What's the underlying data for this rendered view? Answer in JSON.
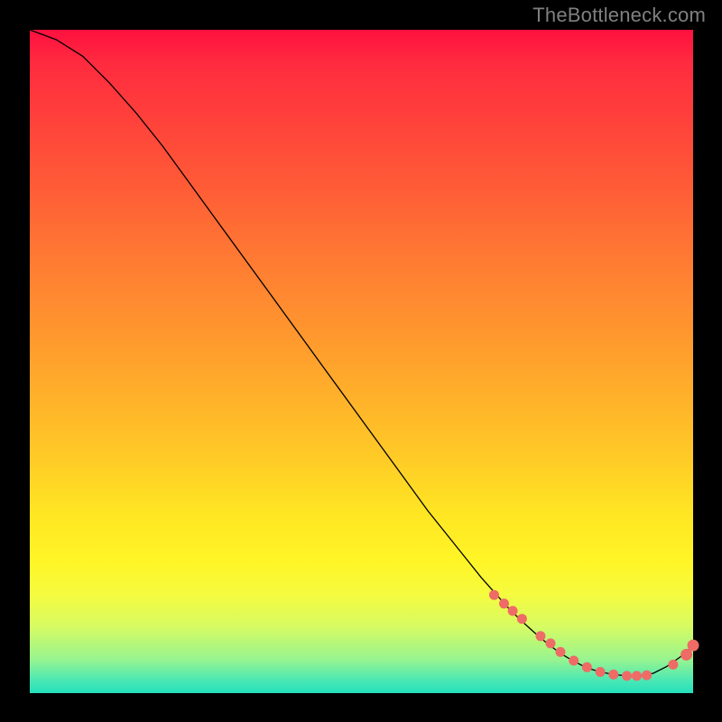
{
  "watermark": "TheBottleneck.com",
  "chart_data": {
    "type": "line",
    "title": "",
    "xlabel": "",
    "ylabel": "",
    "xlim": [
      0,
      100
    ],
    "ylim": [
      0,
      100
    ],
    "grid": false,
    "legend": false,
    "description": "Single black curve over a vertical gradient (red top → green bottom). Curve descends steeply from top-left, flattens to a minimum near x≈84, then rises slightly. Salmon dots mark points along the lower portion of the curve.",
    "series": [
      {
        "name": "curve",
        "x": [
          0,
          4,
          8,
          12,
          16,
          20,
          24,
          28,
          32,
          36,
          40,
          44,
          48,
          52,
          56,
          60,
          64,
          68,
          72,
          74,
          76,
          78,
          80,
          82,
          84,
          86,
          88,
          90,
          92,
          94,
          96,
          98,
          100
        ],
        "y": [
          100,
          98.5,
          96,
          92,
          87.5,
          82.5,
          77,
          71.5,
          66,
          60.5,
          55,
          49.5,
          44,
          38.5,
          33,
          27.5,
          22.5,
          17.5,
          13,
          11,
          9.2,
          7.5,
          6,
          4.8,
          3.8,
          3.2,
          2.8,
          2.6,
          2.6,
          3,
          4,
          5.4,
          7.2
        ]
      },
      {
        "name": "dots",
        "x": [
          70,
          71.5,
          72.8,
          74.2,
          77,
          78.5,
          80,
          82,
          84,
          86,
          88,
          90,
          91.5,
          93,
          97,
          99,
          100
        ],
        "y": [
          14.8,
          13.5,
          12.4,
          11.2,
          8.6,
          7.5,
          6.2,
          4.9,
          3.9,
          3.2,
          2.8,
          2.6,
          2.6,
          2.7,
          4.3,
          5.8,
          7.2
        ]
      }
    ]
  }
}
